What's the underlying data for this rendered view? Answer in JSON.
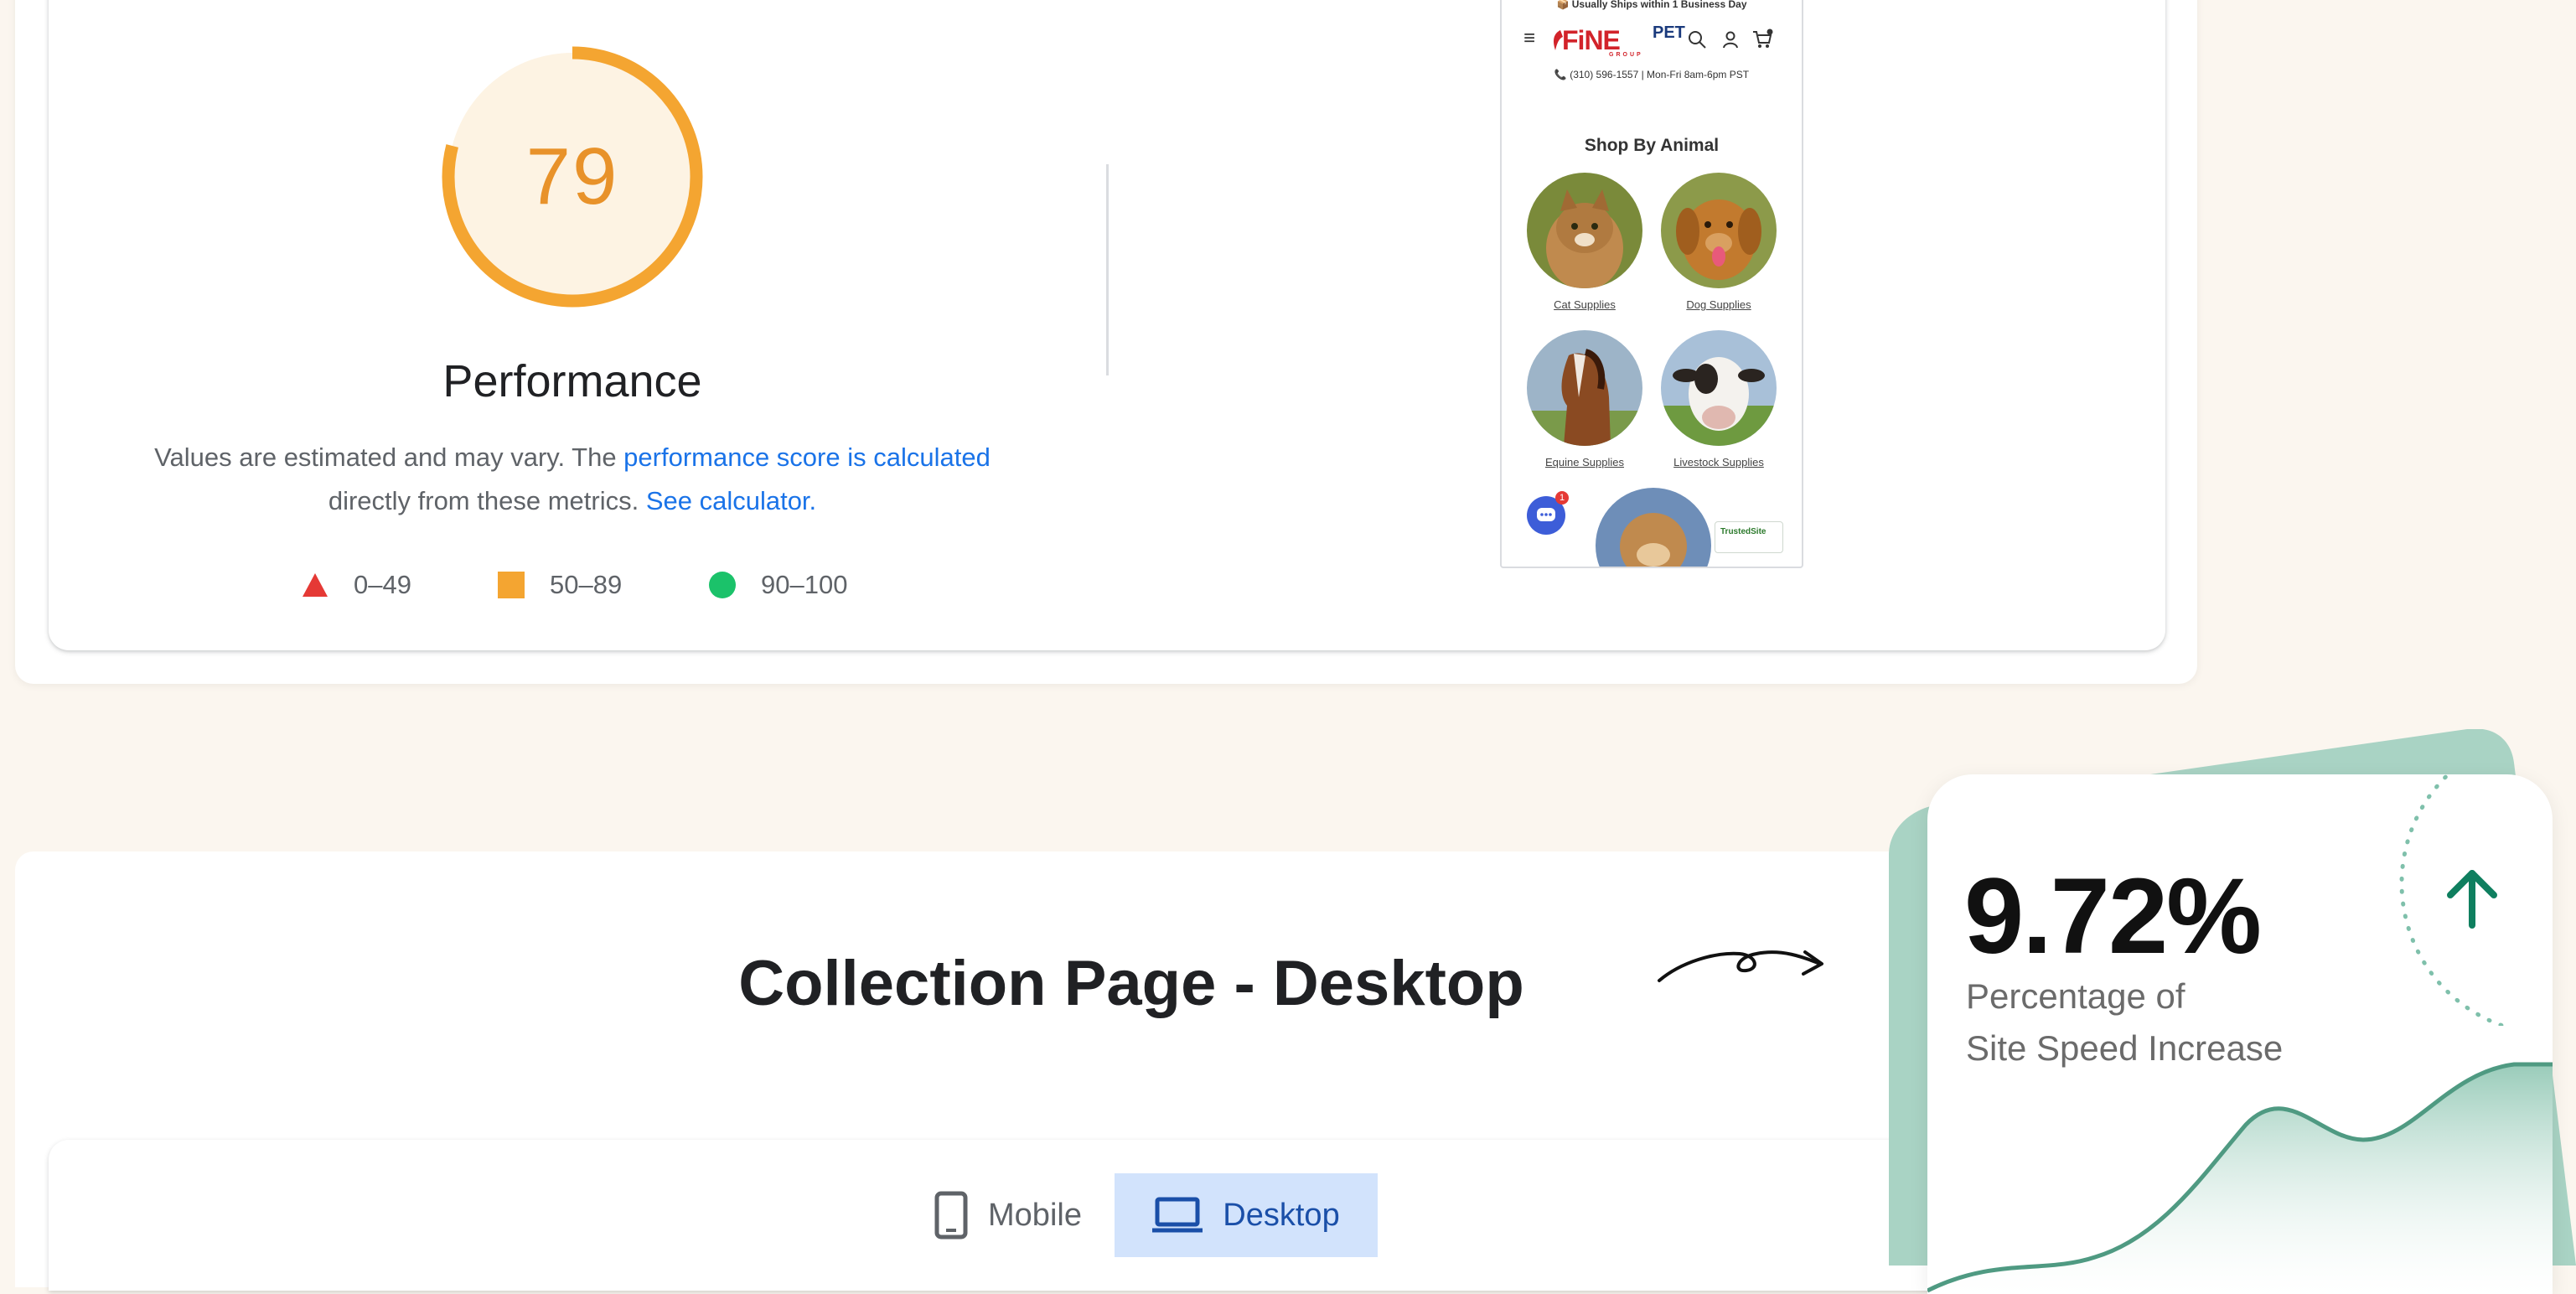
{
  "performance": {
    "score": "79",
    "score_fraction": 0.79,
    "title": "Performance",
    "desc_prefix": "Values are estimated and may vary. The ",
    "desc_link1": "performance score is calculated",
    "desc_middle": "directly from these metrics. ",
    "desc_link2": "See calculator.",
    "legend": [
      {
        "label": "0–49",
        "shape": "triangle",
        "color": "#e53935"
      },
      {
        "label": "50–89",
        "shape": "square",
        "color": "#f4a531"
      },
      {
        "label": "90–100",
        "shape": "circle",
        "color": "#1bc26a"
      }
    ],
    "colors": {
      "gauge_stroke": "#f4a531",
      "gauge_fill": "#fdf3e3",
      "score_text": "#e8922a"
    }
  },
  "phone": {
    "ship_note": "📦 Usually Ships within 1 Business Day",
    "logo_text": "FiNE",
    "logo_pet": "PET",
    "logo_sub": "GROUP",
    "contact": "📞 (310) 596-1557 | Mon-Fri 8am-6pm PST",
    "shop_title": "Shop By Animal",
    "animals": [
      {
        "label": "Cat Supplies",
        "icon": "cat-photo"
      },
      {
        "label": "Dog Supplies",
        "icon": "dog-photo"
      },
      {
        "label": "Equine Supplies",
        "icon": "horse-photo"
      },
      {
        "label": "Livestock Supplies",
        "icon": "cow-photo"
      }
    ],
    "chat_badge": "1",
    "trusted": "TrustedSite"
  },
  "section": {
    "title": "Collection Page - Desktop"
  },
  "tabs": {
    "mobile": "Mobile",
    "desktop": "Desktop"
  },
  "stat": {
    "value": "9.72%",
    "label_line1": "Percentage of",
    "label_line2": "Site Speed Increase",
    "accent": "#0f7f5f",
    "wave_color": "#5fa58f"
  }
}
